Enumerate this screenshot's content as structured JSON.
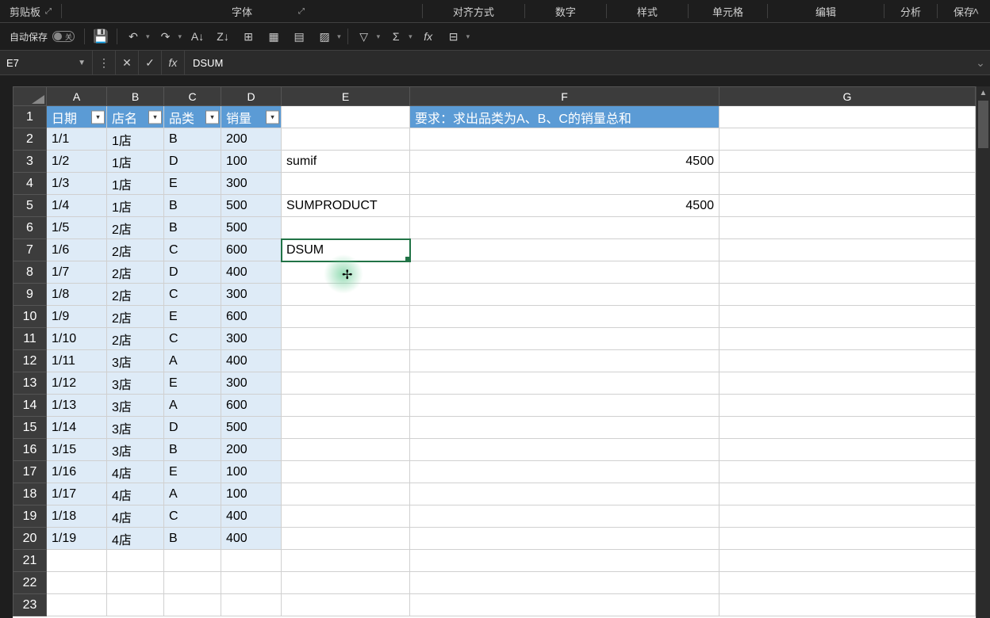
{
  "ribbon": {
    "groups": [
      "剪贴板",
      "字体",
      "对齐方式",
      "数字",
      "样式",
      "单元格",
      "编辑",
      "分析",
      "保存"
    ]
  },
  "qat": {
    "autosave_label": "自动保存",
    "toggle_state": "关"
  },
  "formula_bar": {
    "name_box": "E7",
    "formula": "DSUM"
  },
  "grid": {
    "columns": [
      "A",
      "B",
      "C",
      "D",
      "E",
      "F",
      "G"
    ],
    "headers": {
      "A": "日期",
      "B": "店名",
      "C": "品类",
      "D": "销量"
    },
    "requirement": "要求：求出品类为A、B、C的销量总和",
    "e_values": {
      "3": "sumif",
      "5": "SUMPRODUCT",
      "7": "DSUM"
    },
    "f_values": {
      "3": "4500",
      "5": "4500"
    },
    "rows": [
      {
        "A": "1/1",
        "B": "1店",
        "C": "B",
        "D": "200"
      },
      {
        "A": "1/2",
        "B": "1店",
        "C": "D",
        "D": "100"
      },
      {
        "A": "1/3",
        "B": "1店",
        "C": "E",
        "D": "300"
      },
      {
        "A": "1/4",
        "B": "1店",
        "C": "B",
        "D": "500"
      },
      {
        "A": "1/5",
        "B": "2店",
        "C": "B",
        "D": "500"
      },
      {
        "A": "1/6",
        "B": "2店",
        "C": "C",
        "D": "600"
      },
      {
        "A": "1/7",
        "B": "2店",
        "C": "D",
        "D": "400"
      },
      {
        "A": "1/8",
        "B": "2店",
        "C": "C",
        "D": "300"
      },
      {
        "A": "1/9",
        "B": "2店",
        "C": "E",
        "D": "600"
      },
      {
        "A": "1/10",
        "B": "2店",
        "C": "C",
        "D": "300"
      },
      {
        "A": "1/11",
        "B": "3店",
        "C": "A",
        "D": "400"
      },
      {
        "A": "1/12",
        "B": "3店",
        "C": "E",
        "D": "300"
      },
      {
        "A": "1/13",
        "B": "3店",
        "C": "A",
        "D": "600"
      },
      {
        "A": "1/14",
        "B": "3店",
        "C": "D",
        "D": "500"
      },
      {
        "A": "1/15",
        "B": "3店",
        "C": "B",
        "D": "200"
      },
      {
        "A": "1/16",
        "B": "4店",
        "C": "E",
        "D": "100"
      },
      {
        "A": "1/17",
        "B": "4店",
        "C": "A",
        "D": "100"
      },
      {
        "A": "1/18",
        "B": "4店",
        "C": "C",
        "D": "400"
      },
      {
        "A": "1/19",
        "B": "4店",
        "C": "B",
        "D": "400"
      }
    ],
    "total_rows_visible": 23
  }
}
